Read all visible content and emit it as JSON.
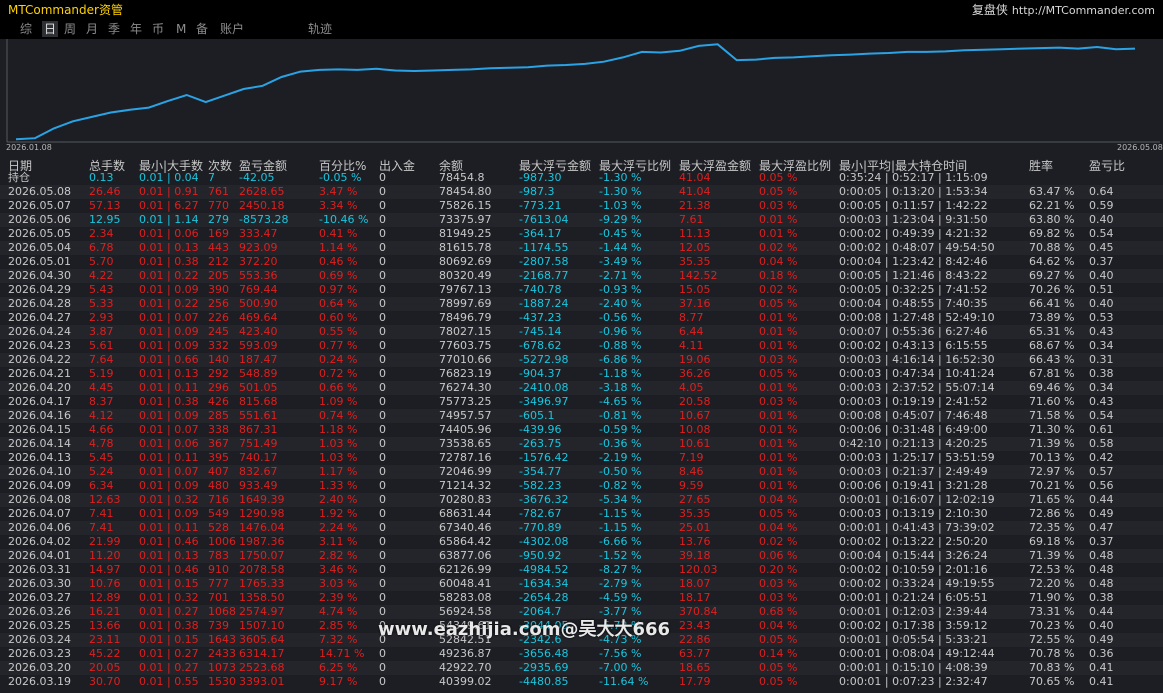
{
  "app": {
    "title": "MTCommander资管",
    "brand_label": "复盘侠",
    "url": "http://MTCommander.com"
  },
  "tabs": [
    "综",
    "日",
    "周",
    "月",
    "季",
    "年",
    "币",
    "M",
    "备",
    "账户",
    "轨迹"
  ],
  "active_tab": "日",
  "chart_data": {
    "type": "line",
    "x_start_label": "2026.01.08",
    "x_end_label": "2026.05.08",
    "series": [
      {
        "values": [
          64500,
          64700,
          66500,
          67800,
          68600,
          69400,
          69900,
          70300,
          71500,
          72600,
          71300,
          72500,
          73700,
          74300,
          75900,
          76900,
          77200,
          77300,
          77200,
          77400,
          77100,
          77000,
          77100,
          77200,
          77300,
          77500,
          77600,
          77700,
          78000,
          78100,
          78300,
          78700,
          79500,
          80500,
          80400,
          80700,
          81600,
          81900,
          79000,
          79100,
          79400,
          79500,
          79700,
          79900,
          80000,
          80200,
          80300,
          80500,
          80500,
          80600,
          80800,
          80900,
          81000,
          81100,
          81200,
          81300,
          81100,
          81400,
          81000,
          81100
        ]
      }
    ],
    "color": "#2aa3e6"
  },
  "table": {
    "headers": [
      "日期",
      "总手数",
      "最小|大手数",
      "次数",
      "盈亏金额",
      "百分比%",
      "出入金",
      "余额",
      "最大浮亏金额",
      "最大浮亏比例",
      "最大浮盈金额",
      "最大浮盈比例",
      "最小|平均|最大持仓时间",
      "胜率",
      "盈亏比"
    ],
    "position_row": {
      "label": "持仓",
      "lots": "0.13",
      "minmax": "0.01 | 0.04",
      "count": "7",
      "pnl": "-42.05",
      "pct": "-0.05 %",
      "io": "0",
      "balance": "78454.8",
      "maxloss": "-987.30",
      "maxloss_pct": "-1.30 %",
      "maxgain": "41.04",
      "maxgain_pct": "0.05 %",
      "hold": "0:35:24 | 0:52:17 | 1:15:09"
    },
    "rows": [
      [
        "2026.05.08",
        "26.46",
        "0.01 | 0.91",
        "761",
        "2628.65",
        "3.47 %",
        "0",
        "78454.80",
        "-987.3",
        "-1.30 %",
        "41.04",
        "0.05 %",
        "0:00:05 | 0:13:20 | 1:53:34",
        "63.47 %",
        "0.64"
      ],
      [
        "2026.05.07",
        "57.13",
        "0.01 | 6.27",
        "770",
        "2450.18",
        "3.34 %",
        "0",
        "75826.15",
        "-773.21",
        "-1.03 %",
        "21.38",
        "0.03 %",
        "0:00:05 | 0:11:57 | 1:42:22",
        "62.21 %",
        "0.59"
      ],
      [
        "2026.05.06",
        "12.95",
        "0.01 | 1.14",
        "279",
        "-8573.28",
        "-10.46 %",
        "0",
        "73375.97",
        "-7613.04",
        "-9.29 %",
        "7.61",
        "0.01 %",
        "0:00:03 | 1:23:04 | 9:31:50",
        "63.80 %",
        "0.40"
      ],
      [
        "2026.05.05",
        "2.34",
        "0.01 | 0.06",
        "169",
        "333.47",
        "0.41 %",
        "0",
        "81949.25",
        "-364.17",
        "-0.45 %",
        "11.13",
        "0.01 %",
        "0:00:02 | 0:49:39 | 4:21:32",
        "69.82 %",
        "0.54"
      ],
      [
        "2026.05.04",
        "6.78",
        "0.01 | 0.13",
        "443",
        "923.09",
        "1.14 %",
        "0",
        "81615.78",
        "-1174.55",
        "-1.44 %",
        "12.05",
        "0.02 %",
        "0:00:02 | 0:48:07 | 49:54:50",
        "70.88 %",
        "0.45"
      ],
      [
        "2026.05.01",
        "5.70",
        "0.01 | 0.38",
        "212",
        "372.20",
        "0.46 %",
        "0",
        "80692.69",
        "-2807.58",
        "-3.49 %",
        "35.35",
        "0.04 %",
        "0:00:04 | 1:23:42 | 8:42:46",
        "64.62 %",
        "0.37"
      ],
      [
        "2026.04.30",
        "4.22",
        "0.01 | 0.22",
        "205",
        "553.36",
        "0.69 %",
        "0",
        "80320.49",
        "-2168.77",
        "-2.71 %",
        "142.52",
        "0.18 %",
        "0:00:05 | 1:21:46 | 8:43:22",
        "69.27 %",
        "0.40"
      ],
      [
        "2026.04.29",
        "5.43",
        "0.01 | 0.09",
        "390",
        "769.44",
        "0.97 %",
        "0",
        "79767.13",
        "-740.78",
        "-0.93 %",
        "15.05",
        "0.02 %",
        "0:00:05 | 0:32:25 | 7:41:52",
        "70.26 %",
        "0.51"
      ],
      [
        "2026.04.28",
        "5.33",
        "0.01 | 0.22",
        "256",
        "500.90",
        "0.64 %",
        "0",
        "78997.69",
        "-1887.24",
        "-2.40 %",
        "37.16",
        "0.05 %",
        "0:00:04 | 0:48:55 | 7:40:35",
        "66.41 %",
        "0.40"
      ],
      [
        "2026.04.27",
        "2.93",
        "0.01 | 0.07",
        "226",
        "469.64",
        "0.60 %",
        "0",
        "78496.79",
        "-437.23",
        "-0.56 %",
        "8.77",
        "0.01 %",
        "0:00:08 | 1:27:48 | 52:49:10",
        "73.89 %",
        "0.53"
      ],
      [
        "2026.04.24",
        "3.87",
        "0.01 | 0.09",
        "245",
        "423.40",
        "0.55 %",
        "0",
        "78027.15",
        "-745.14",
        "-0.96 %",
        "6.44",
        "0.01 %",
        "0:00:07 | 0:55:36 | 6:27:46",
        "65.31 %",
        "0.43"
      ],
      [
        "2026.04.23",
        "5.61",
        "0.01 | 0.09",
        "332",
        "593.09",
        "0.77 %",
        "0",
        "77603.75",
        "-678.62",
        "-0.88 %",
        "4.11",
        "0.01 %",
        "0:00:02 | 0:43:13 | 6:15:55",
        "68.67 %",
        "0.34"
      ],
      [
        "2026.04.22",
        "7.64",
        "0.01 | 0.66",
        "140",
        "187.47",
        "0.24 %",
        "0",
        "77010.66",
        "-5272.98",
        "-6.86 %",
        "19.06",
        "0.03 %",
        "0:00:03 | 4:16:14 | 16:52:30",
        "66.43 %",
        "0.31"
      ],
      [
        "2026.04.21",
        "5.19",
        "0.01 | 0.13",
        "292",
        "548.89",
        "0.72 %",
        "0",
        "76823.19",
        "-904.37",
        "-1.18 %",
        "36.26",
        "0.05 %",
        "0:00:03 | 0:47:34 | 10:41:24",
        "67.81 %",
        "0.38"
      ],
      [
        "2026.04.20",
        "4.45",
        "0.01 | 0.11",
        "296",
        "501.05",
        "0.66 %",
        "0",
        "76274.30",
        "-2410.08",
        "-3.18 %",
        "4.05",
        "0.01 %",
        "0:00:03 | 2:37:52 | 55:07:14",
        "69.46 %",
        "0.34"
      ],
      [
        "2026.04.17",
        "8.37",
        "0.01 | 0.38",
        "426",
        "815.68",
        "1.09 %",
        "0",
        "75773.25",
        "-3496.97",
        "-4.65 %",
        "20.58",
        "0.03 %",
        "0:00:03 | 0:19:19 | 2:41:52",
        "71.60 %",
        "0.43"
      ],
      [
        "2026.04.16",
        "4.12",
        "0.01 | 0.09",
        "285",
        "551.61",
        "0.74 %",
        "0",
        "74957.57",
        "-605.1",
        "-0.81 %",
        "10.67",
        "0.01 %",
        "0:00:08 | 0:45:07 | 7:46:48",
        "71.58 %",
        "0.54"
      ],
      [
        "2026.04.15",
        "4.66",
        "0.01 | 0.07",
        "338",
        "867.31",
        "1.18 %",
        "0",
        "74405.96",
        "-439.96",
        "-0.59 %",
        "10.08",
        "0.01 %",
        "0:00:06 | 0:31:48 | 6:49:00",
        "71.30 %",
        "0.61"
      ],
      [
        "2026.04.14",
        "4.78",
        "0.01 | 0.06",
        "367",
        "751.49",
        "1.03 %",
        "0",
        "73538.65",
        "-263.75",
        "-0.36 %",
        "10.61",
        "0.01 %",
        "0:42:10 | 0:21:13 | 4:20:25",
        "71.39 %",
        "0.58"
      ],
      [
        "2026.04.13",
        "5.45",
        "0.01 | 0.11",
        "395",
        "740.17",
        "1.03 %",
        "0",
        "72787.16",
        "-1576.42",
        "-2.19 %",
        "7.19",
        "0.01 %",
        "0:00:03 | 1:25:17 | 53:51:59",
        "70.13 %",
        "0.42"
      ],
      [
        "2026.04.10",
        "5.24",
        "0.01 | 0.07",
        "407",
        "832.67",
        "1.17 %",
        "0",
        "72046.99",
        "-354.77",
        "-0.50 %",
        "8.46",
        "0.01 %",
        "0:00:03 | 0:21:37 | 2:49:49",
        "72.97 %",
        "0.57"
      ],
      [
        "2026.04.09",
        "6.34",
        "0.01 | 0.09",
        "480",
        "933.49",
        "1.33 %",
        "0",
        "71214.32",
        "-582.23",
        "-0.82 %",
        "9.59",
        "0.01 %",
        "0:00:06 | 0:19:41 | 3:21:28",
        "70.21 %",
        "0.56"
      ],
      [
        "2026.04.08",
        "12.63",
        "0.01 | 0.32",
        "716",
        "1649.39",
        "2.40 %",
        "0",
        "70280.83",
        "-3676.32",
        "-5.34 %",
        "27.65",
        "0.04 %",
        "0:00:01 | 0:16:07 | 12:02:19",
        "71.65 %",
        "0.44"
      ],
      [
        "2026.04.07",
        "7.41",
        "0.01 | 0.09",
        "549",
        "1290.98",
        "1.92 %",
        "0",
        "68631.44",
        "-782.67",
        "-1.15 %",
        "35.35",
        "0.05 %",
        "0:00:03 | 0:13:19 | 2:10:30",
        "72.86 %",
        "0.49"
      ],
      [
        "2026.04.06",
        "7.41",
        "0.01 | 0.11",
        "528",
        "1476.04",
        "2.24 %",
        "0",
        "67340.46",
        "-770.89",
        "-1.15 %",
        "25.01",
        "0.04 %",
        "0:00:01 | 0:41:43 | 73:39:02",
        "72.35 %",
        "0.47"
      ],
      [
        "2026.04.02",
        "21.99",
        "0.01 | 0.46",
        "1006",
        "1987.36",
        "3.11 %",
        "0",
        "65864.42",
        "-4302.08",
        "-6.66 %",
        "13.76",
        "0.02 %",
        "0:00:02 | 0:13:22 | 2:50:20",
        "69.18 %",
        "0.37"
      ],
      [
        "2026.04.01",
        "11.20",
        "0.01 | 0.13",
        "783",
        "1750.07",
        "2.82 %",
        "0",
        "63877.06",
        "-950.92",
        "-1.52 %",
        "39.18",
        "0.06 %",
        "0:00:04 | 0:15:44 | 3:26:24",
        "71.39 %",
        "0.48"
      ],
      [
        "2026.03.31",
        "14.97",
        "0.01 | 0.46",
        "910",
        "2078.58",
        "3.46 %",
        "0",
        "62126.99",
        "-4984.52",
        "-8.27 %",
        "120.03",
        "0.20 %",
        "0:00:02 | 0:10:59 | 2:01:16",
        "72.53 %",
        "0.48"
      ],
      [
        "2026.03.30",
        "10.76",
        "0.01 | 0.15",
        "777",
        "1765.33",
        "3.03 %",
        "0",
        "60048.41",
        "-1634.34",
        "-2.79 %",
        "18.07",
        "0.03 %",
        "0:00:02 | 0:33:24 | 49:19:55",
        "72.20 %",
        "0.48"
      ],
      [
        "2026.03.27",
        "12.89",
        "0.01 | 0.32",
        "701",
        "1358.50",
        "2.39 %",
        "0",
        "58283.08",
        "-2654.28",
        "-4.59 %",
        "18.17",
        "0.03 %",
        "0:00:01 | 0:21:24 | 6:05:51",
        "71.90 %",
        "0.38"
      ],
      [
        "2026.03.26",
        "16.21",
        "0.01 | 0.27",
        "1068",
        "2574.97",
        "4.74 %",
        "0",
        "56924.58",
        "-2064.7",
        "-3.77 %",
        "370.84",
        "0.68 %",
        "0:00:01 | 0:12:03 | 2:39:44",
        "73.31 %",
        "0.44"
      ],
      [
        "2026.03.25",
        "13.66",
        "0.01 | 0.38",
        "739",
        "1507.10",
        "2.85 %",
        "0",
        "54349.61",
        "-3044.05",
        "-5.72 %",
        "23.43",
        "0.04 %",
        "0:00:02 | 0:17:38 | 3:59:12",
        "70.23 %",
        "0.40"
      ],
      [
        "2026.03.24",
        "23.11",
        "0.01 | 0.15",
        "1643",
        "3605.64",
        "7.32 %",
        "0",
        "52842.51",
        "-2342.6",
        "-4.73 %",
        "22.86",
        "0.05 %",
        "0:00:01 | 0:05:54 | 5:33:21",
        "72.55 %",
        "0.49"
      ],
      [
        "2026.03.23",
        "45.22",
        "0.01 | 0.27",
        "2433",
        "6314.17",
        "14.71 %",
        "0",
        "49236.87",
        "-3656.48",
        "-7.56 %",
        "63.77",
        "0.14 %",
        "0:00:01 | 0:08:04 | 49:12:44",
        "70.78 %",
        "0.36"
      ],
      [
        "2026.03.20",
        "20.05",
        "0.01 | 0.27",
        "1073",
        "2523.68",
        "6.25 %",
        "0",
        "42922.70",
        "-2935.69",
        "-7.00 %",
        "18.65",
        "0.05 %",
        "0:00:01 | 0:15:10 | 4:08:39",
        "70.83 %",
        "0.41"
      ],
      [
        "2026.03.19",
        "30.70",
        "0.01 | 0.55",
        "1530",
        "3393.01",
        "9.17 %",
        "0",
        "40399.02",
        "-4480.85",
        "-11.64 %",
        "17.79",
        "0.05 %",
        "0:00:01 | 0:07:23 | 2:32:47",
        "70.65 %",
        "0.41"
      ]
    ]
  },
  "watermark": "www.eazhijia.com@吴大大666"
}
